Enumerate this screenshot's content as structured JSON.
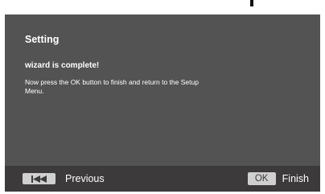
{
  "dialog": {
    "title": "Setting",
    "subtitle": "wizard is complete!",
    "message": "Now press the OK button to finish and return to the Setup Menu."
  },
  "footer": {
    "previous": {
      "icon": "skip-back-icon",
      "label": "Previous"
    },
    "finish": {
      "key_label": "OK",
      "label": "Finish"
    }
  },
  "colors": {
    "screen_bg": "#535353",
    "footer_bg": "#3c3a3a",
    "key_bg": "#d0d0d0",
    "text": "#ffffff"
  }
}
